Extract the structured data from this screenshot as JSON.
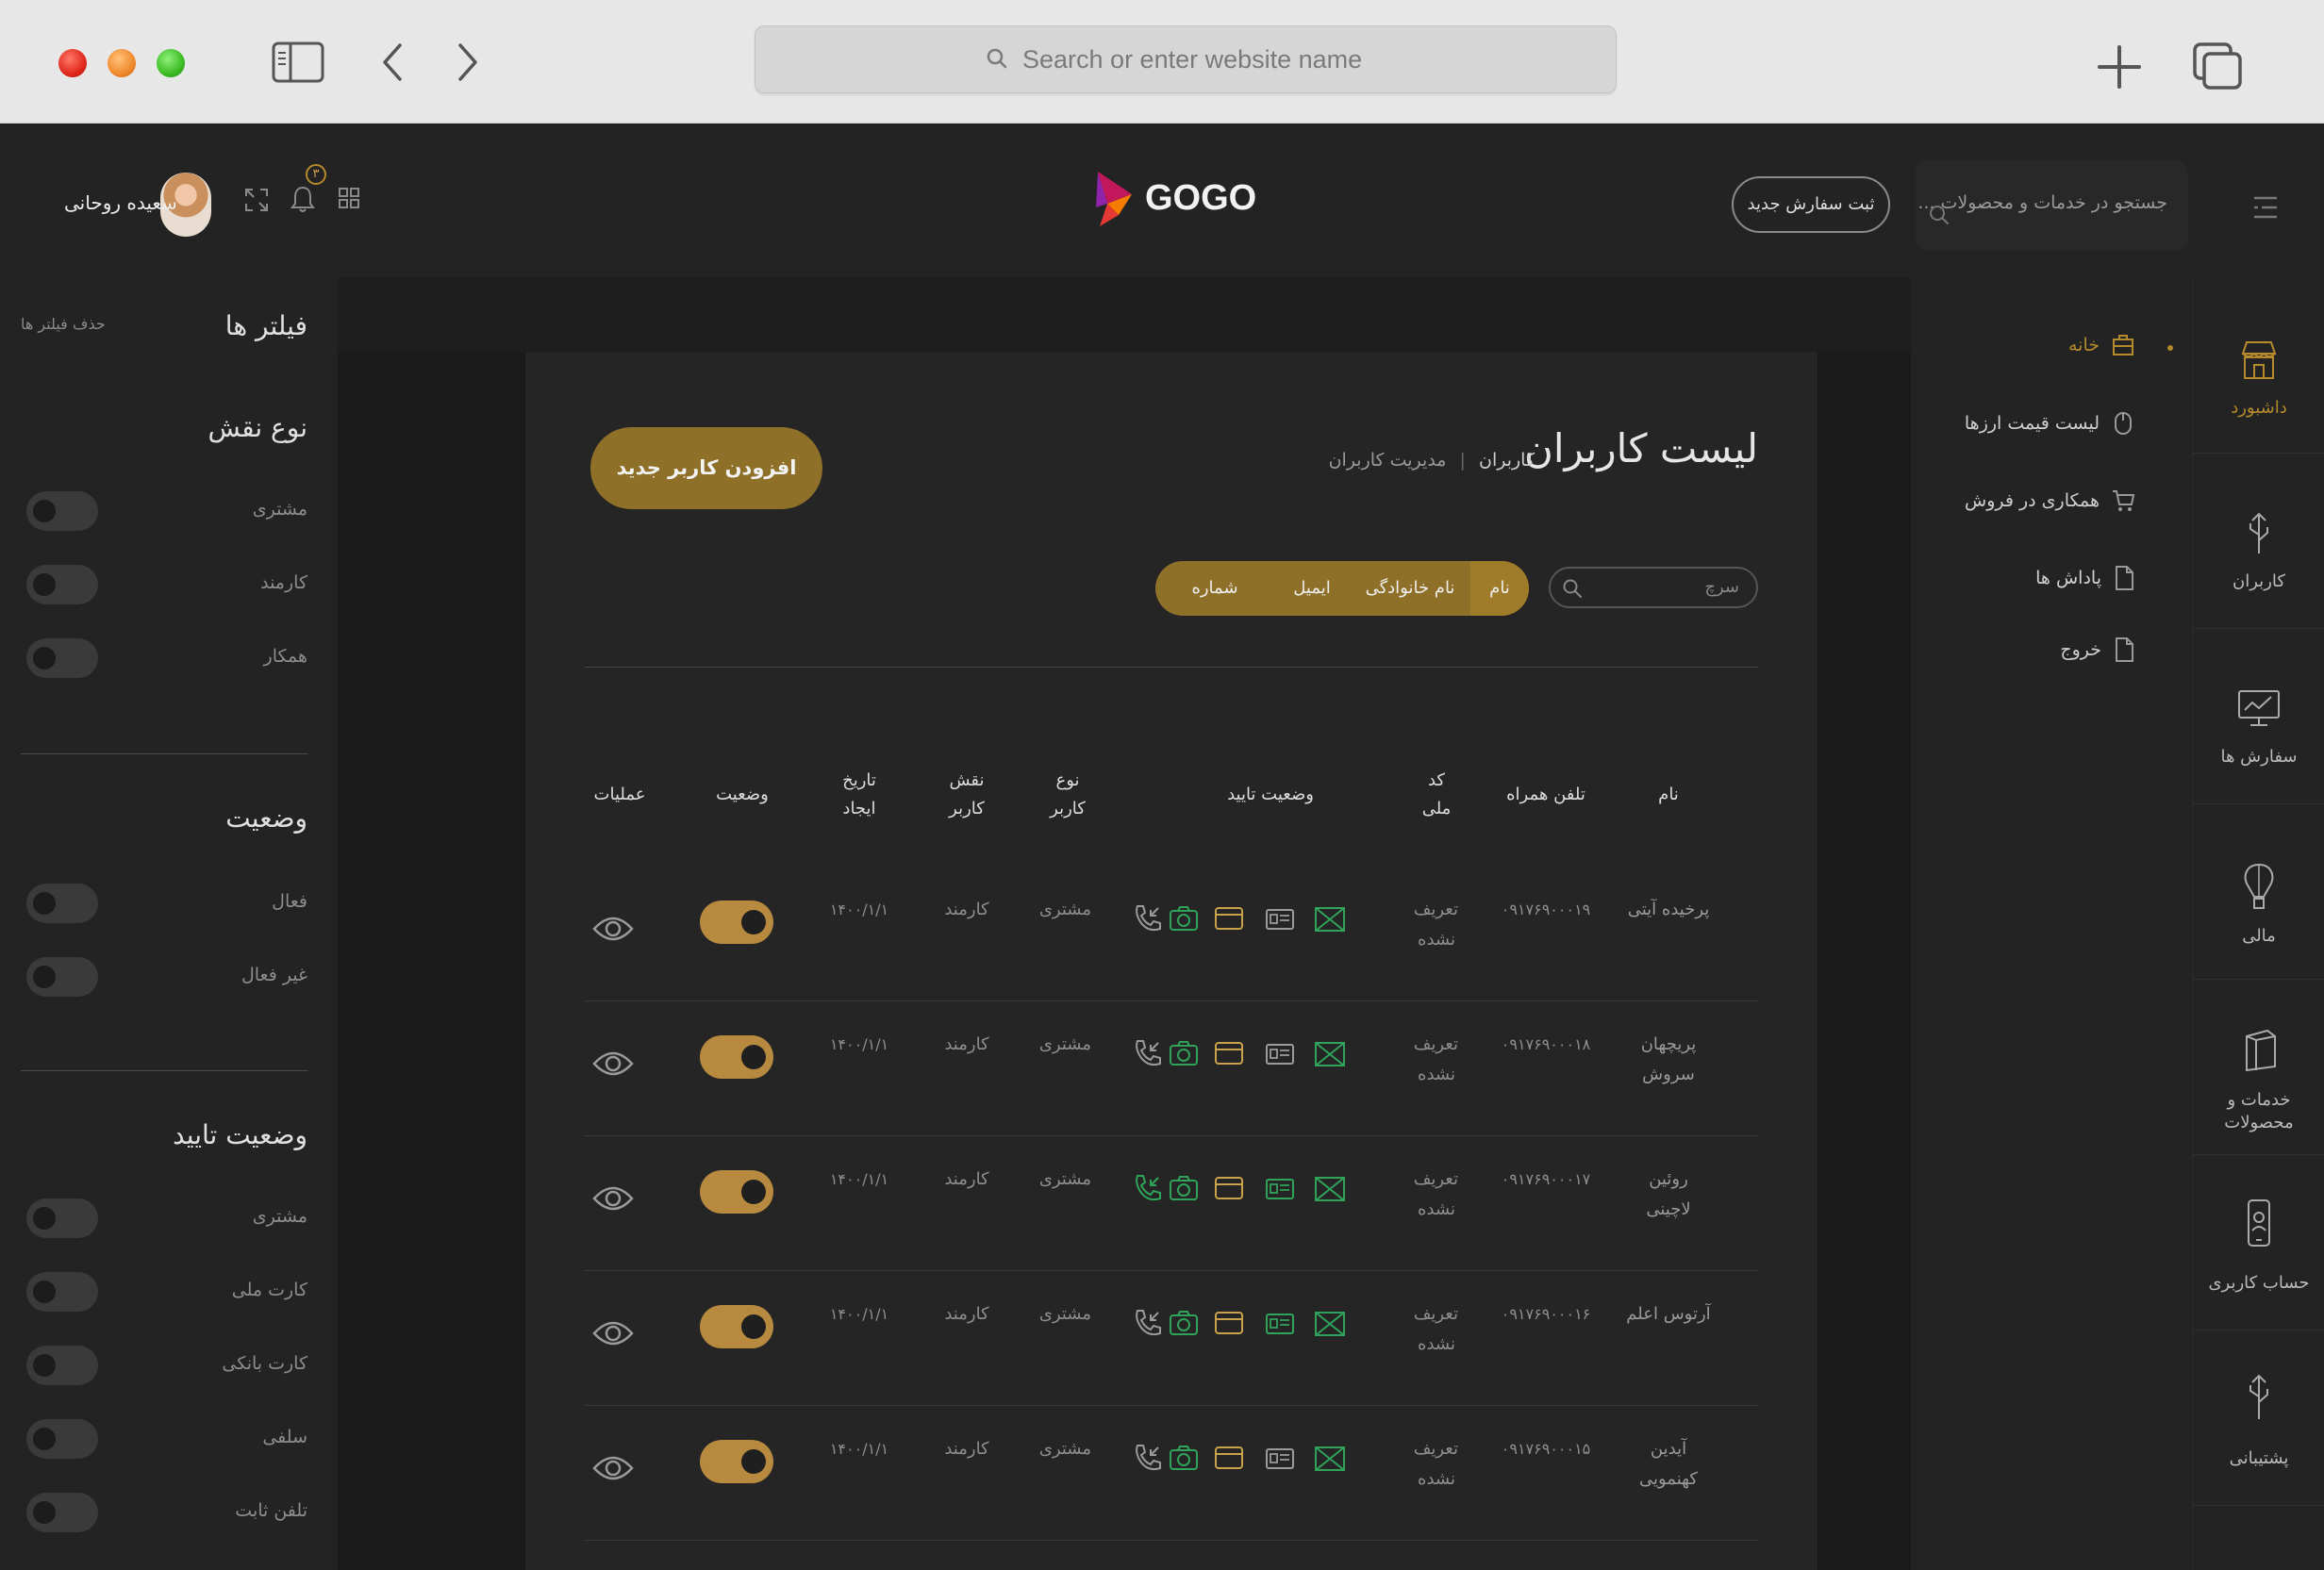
{
  "browser": {
    "url_placeholder": "Search or enter website name"
  },
  "header": {
    "search_placeholder": "جستجو در خدمات و محصولات ...",
    "new_order_label": "ثبت سفارش جدید",
    "logo_text": "GOGO",
    "user_name": "سعیده روحانی",
    "notification_count": "۳"
  },
  "rail": {
    "items": [
      {
        "label": "داشبورد",
        "icon": "store-icon",
        "active": true
      },
      {
        "label": "کاربران",
        "icon": "users-icon"
      },
      {
        "label": "سفارش ها",
        "icon": "monitor-chart-icon"
      },
      {
        "label": "مالی",
        "icon": "balloon-icon"
      },
      {
        "label": "خدمات و محصولات",
        "icon": "box-icon"
      },
      {
        "label": "حساب کاربری",
        "icon": "phone-account-icon"
      },
      {
        "label": "پشتیبانی",
        "icon": "support-icon"
      }
    ]
  },
  "subnav": {
    "items": [
      {
        "label": "خانه",
        "icon": "home-icon",
        "active": true
      },
      {
        "label": "لیست قیمت ارزها",
        "icon": "mouse-icon"
      },
      {
        "label": "همکاری در فروش",
        "icon": "cart-icon"
      },
      {
        "label": "پاداش ها",
        "icon": "file-icon"
      },
      {
        "label": "خروج",
        "icon": "file-icon"
      }
    ]
  },
  "filters": {
    "title": "فیلتر ها",
    "clear_label": "حذف فیلتر ها",
    "sections": [
      {
        "title": "نوع نقش",
        "options": [
          "مشتری",
          "کارمند",
          "همکار"
        ]
      },
      {
        "title": "وضعیت",
        "options": [
          "فعال",
          "غیر فعال"
        ]
      },
      {
        "title": "وضعیت تایید",
        "options": [
          "مشتری",
          "کارت ملی",
          "کارت بانکی",
          "سلفی",
          "تلفن ثابت"
        ]
      }
    ]
  },
  "page": {
    "title": "لیست کاربران",
    "breadcrumb_current": "کاربران",
    "breadcrumb_parent": "مدیریت کاربران",
    "add_user_label": "افزودن کاربر جدید",
    "search_placeholder": "سرچ",
    "search_fields": [
      "نام",
      "نام خانوادگی",
      "ایمیل",
      "شماره همراه"
    ],
    "active_search_field": "نام"
  },
  "table": {
    "columns": {
      "name": "نام",
      "phone": "تلفن همراه",
      "national_code": "کد ملی",
      "verification": "وضعیت تایید",
      "user_type": "نوع کاربر",
      "user_role": "نقش کاربر",
      "created": "تاریخ ایجاد",
      "status": "وضعیت",
      "actions": "عملیات"
    },
    "rows": [
      {
        "name": "پرخیده آیتی",
        "phone": "۰۹۱۷۶۹۰۰۰۱۹",
        "national_code": "تعریف نشده",
        "user_type": "مشتری",
        "user_role": "کارمند",
        "created": "۱۴۰۰/۱/۱",
        "status_on": true
      },
      {
        "name": "پریچهان سروش",
        "phone": "۰۹۱۷۶۹۰۰۰۱۸",
        "national_code": "تعریف نشده",
        "user_type": "مشتری",
        "user_role": "کارمند",
        "created": "۱۴۰۰/۱/۱",
        "status_on": true
      },
      {
        "name": "روئین لاچینی",
        "phone": "۰۹۱۷۶۹۰۰۰۱۷",
        "national_code": "تعریف نشده",
        "user_type": "مشتری",
        "user_role": "کارمند",
        "created": "۱۴۰۰/۱/۱",
        "status_on": true
      },
      {
        "name": "آرتوس اعلم",
        "phone": "۰۹۱۷۶۹۰۰۰۱۶",
        "national_code": "تعریف نشده",
        "user_type": "مشتری",
        "user_role": "کارمند",
        "created": "۱۴۰۰/۱/۱",
        "status_on": true
      },
      {
        "name": "آیدین کهنمویی",
        "phone": "۰۹۱۷۶۹۰۰۰۱۵",
        "national_code": "تعریف نشده",
        "user_type": "مشتری",
        "user_role": "کارمند",
        "created": "۱۴۰۰/۱/۱",
        "status_on": true
      }
    ]
  },
  "colors": {
    "accent": "#8e7028",
    "toggle_on": "#b88a40",
    "verified_green": "#2fa35a",
    "pending_gold": "#c9a24a"
  }
}
